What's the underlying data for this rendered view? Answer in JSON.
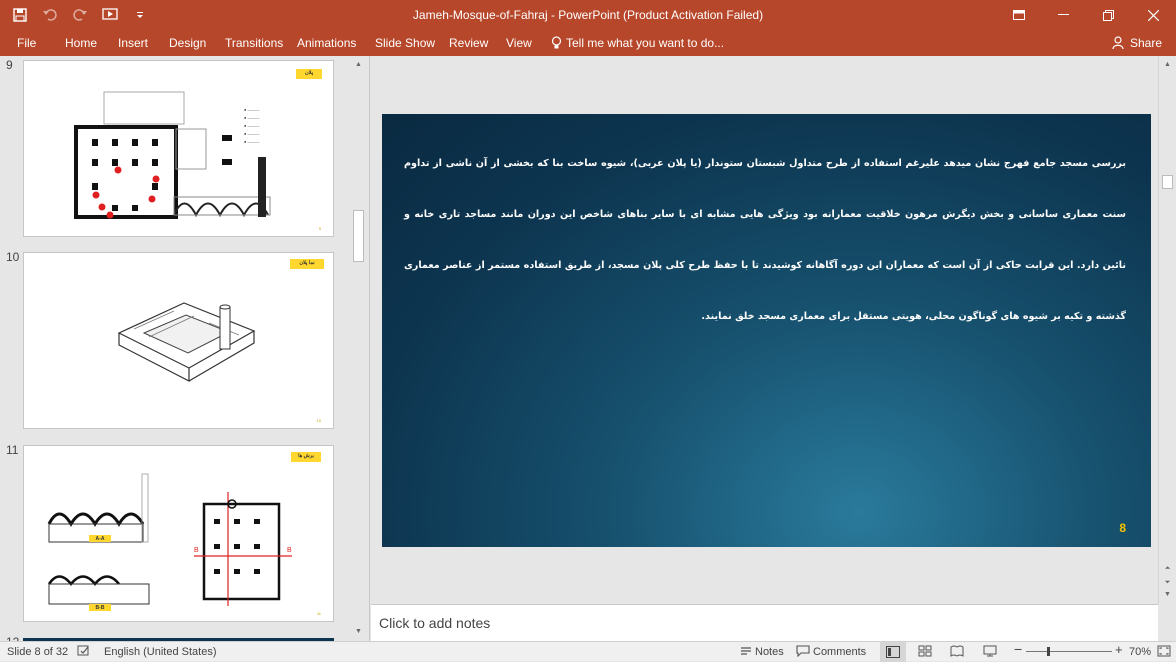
{
  "window": {
    "title": "Jameh-Mosque-of-Fahraj - PowerPoint (Product Activation Failed)",
    "controls": [
      "ribbon-display-icon",
      "minimize-icon",
      "restore-icon",
      "close-icon"
    ]
  },
  "qat": {
    "icons": [
      "save-icon",
      "undo-icon",
      "redo-icon",
      "start-from-beginning-icon",
      "customize-qat-icon"
    ]
  },
  "ribbon": {
    "tabs": [
      "File",
      "Home",
      "Insert",
      "Design",
      "Transitions",
      "Animations",
      "Slide Show",
      "Review",
      "View"
    ],
    "tell_me": "Tell me what you want to do...",
    "share": "Share"
  },
  "thumbnails": [
    {
      "number": "9",
      "label": "پلان",
      "page": "9"
    },
    {
      "number": "10",
      "label": "نما پلان",
      "page": "10"
    },
    {
      "number": "11",
      "label": "برش ها",
      "page": "11",
      "captions": [
        "A-A",
        "B-B"
      ]
    },
    {
      "number": "12"
    }
  ],
  "slide": {
    "text": "بررسی مسجد جامع فهرج نشان میدهد علیرغم استفاده از طرح متداول شبستان ستوندار (یا پلان عربی)، شیوه ساخت بنا که بخشی از آن ناشی از تداوم سنت معماری ساسانی و بخش دیگرش مرهون خلاقیت معمارانه بود ویژگی هایی مشابه ای با سایر بناهای شاخص این دوران مانند مساجد تاری خانه و نائین دارد. این قرابت حاکی از آن است که معماران این دوره آگاهانه کوشیدند تا با حفظ طرح کلی پلان مسجد، از طریق استفاده مستمر از عناصر معماری گذشته و تکیه بر شیوه های گوناگون محلی، هویتی مستقل برای معماری مسجد خلق نمایند.",
    "page_number": "8"
  },
  "notes": {
    "placeholder": "Click to add notes"
  },
  "status": {
    "slide_info": "Slide 8 of 32",
    "language": "English (United States)",
    "notes_label": "Notes",
    "comments_label": "Comments",
    "zoom": "70%"
  },
  "colors": {
    "accent": "#b7472a",
    "slide_bg": "#0d3550",
    "page_number": "#f5c400",
    "yellow_label": "#ffd72e"
  }
}
